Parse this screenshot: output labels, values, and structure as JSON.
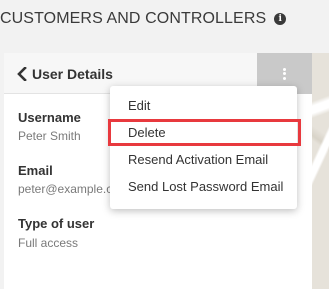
{
  "header": {
    "title": "CUSTOMERS AND CONTROLLERS",
    "info_icon": "info-icon"
  },
  "panel": {
    "back_label": "User Details",
    "back_icon": "chevron-left-icon",
    "menu_icon": "kebab-icon"
  },
  "fields": [
    {
      "label": "Username",
      "value": "Peter Smith"
    },
    {
      "label": "Email",
      "value": "peter@example.c"
    },
    {
      "label": "Type of user",
      "value": "Full access"
    }
  ],
  "menu": {
    "items": [
      {
        "label": "Edit"
      },
      {
        "label": "Delete",
        "highlight_color": "#e8393e"
      },
      {
        "label": "Resend Activation Email"
      },
      {
        "label": "Send Lost Password Email"
      }
    ]
  },
  "colors": {
    "menu_button_bg": "#c9c9c9",
    "highlight": "#e8393e"
  }
}
